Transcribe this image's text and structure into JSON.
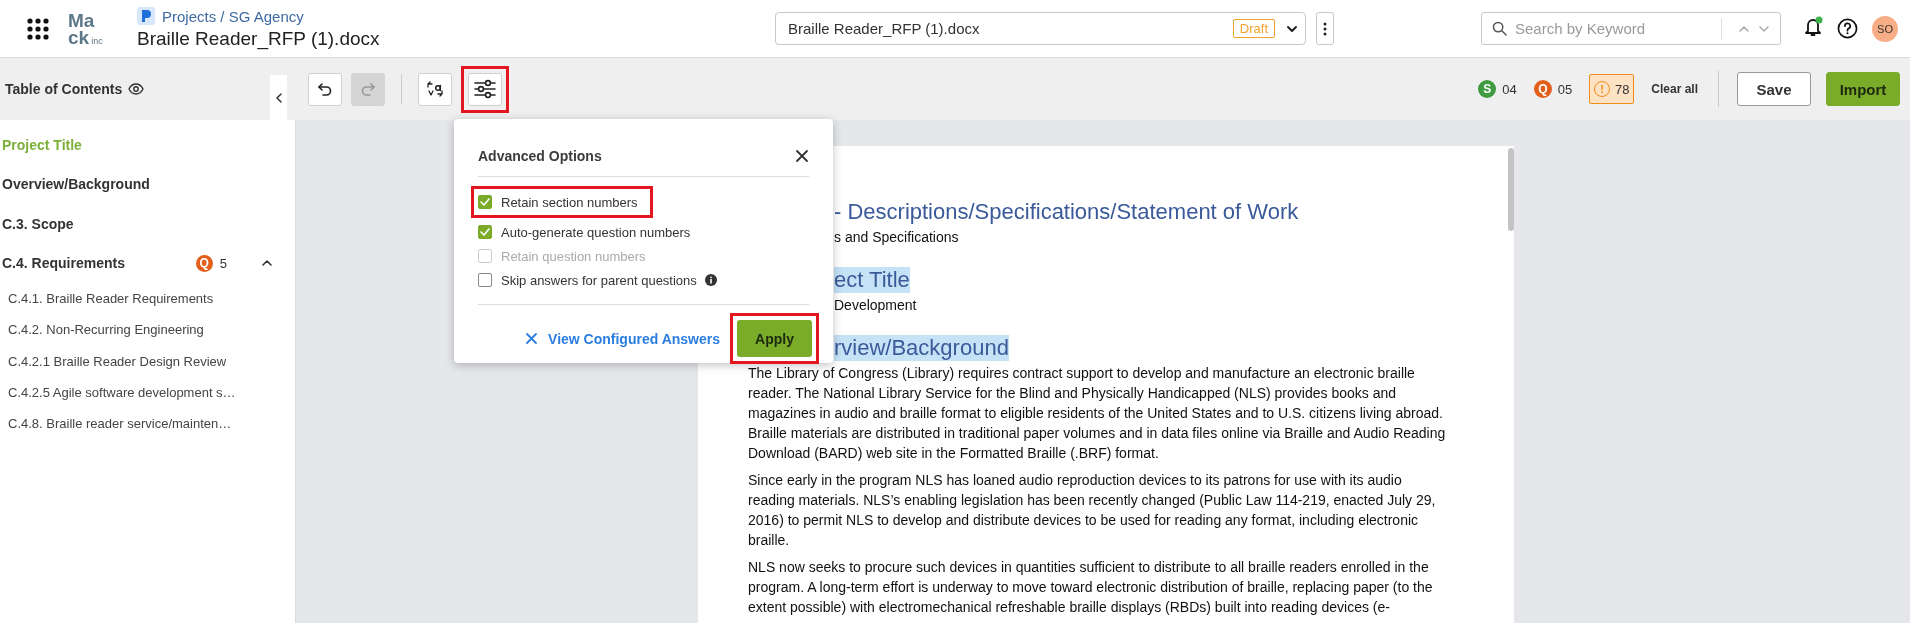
{
  "header": {
    "logo": {
      "top": "Ma",
      "bottom": "ck",
      "suffix": "inc"
    },
    "breadcrumb": "Projects / SG Agency",
    "title": "Braille Reader_RFP (1).docx",
    "document_select": {
      "value": "Braille Reader_RFP (1).docx",
      "status": "Draft"
    },
    "search": {
      "placeholder": "Search by Keyword"
    },
    "notifications": {
      "unread": true
    },
    "avatar": "SO"
  },
  "sidebar": {
    "title": "Table of Contents",
    "items": [
      {
        "label": "Project Title",
        "selected": true
      },
      {
        "label": "Overview/Background",
        "selected": false
      },
      {
        "label": "C.3. Scope",
        "selected": false
      },
      {
        "label": "C.4. Requirements",
        "selected": false,
        "badge": "Q",
        "count": "5",
        "expanded": true,
        "children": [
          {
            "label": "C.4.1. Braille Reader Requirements",
            "selected": false
          },
          {
            "label": "C.4.2. Non-Recurring Engineering",
            "selected": false
          },
          {
            "label": "C.4.2.1 Braille Reader Design Review",
            "selected": false
          },
          {
            "label": "C.4.2.5 Agile software development s…",
            "selected": false
          },
          {
            "label": "C.4.8. Braille reader service/mainten…",
            "selected": false
          }
        ]
      }
    ]
  },
  "toolbar": {
    "tools": [
      {
        "kind": "undo",
        "disabled": false,
        "highlighted": false
      },
      {
        "kind": "redo",
        "disabled": true,
        "highlighted": false
      },
      {
        "kind": "translate",
        "disabled": false,
        "highlighted": false
      },
      {
        "kind": "settings",
        "disabled": false,
        "highlighted": true
      }
    ],
    "counters": [
      {
        "kind": "badge",
        "label": "S",
        "count": "04",
        "color": "#3e9b40"
      },
      {
        "kind": "badge",
        "label": "Q",
        "count": "05",
        "color": "#e2601b"
      },
      {
        "kind": "warning",
        "label": "!",
        "count": "78",
        "color": "#f08c1a"
      }
    ],
    "clear_all": "Clear all",
    "buttons": [
      {
        "label": "Save",
        "kind": "secondary"
      },
      {
        "label": "Import",
        "kind": "primary"
      }
    ]
  },
  "popup": {
    "title": "Advanced Options",
    "options": [
      {
        "label": "Retain section numbers",
        "checked": true,
        "disabled": false,
        "highlighted": true,
        "info": false
      },
      {
        "label": "Auto-generate question numbers",
        "checked": true,
        "disabled": false,
        "highlighted": false,
        "info": false
      },
      {
        "label": "Retain question numbers",
        "checked": false,
        "disabled": true,
        "highlighted": false,
        "info": false
      },
      {
        "label": "Skip answers for parent questions",
        "checked": false,
        "disabled": false,
        "highlighted": false,
        "info": true
      }
    ],
    "link": "View Configured Answers",
    "apply": {
      "label": "Apply",
      "highlighted": true
    }
  },
  "document": {
    "blocks": [
      {
        "kind": "heading",
        "text": "- Descriptions/Specifications/Statement of Work"
      },
      {
        "kind": "subtext",
        "text": "s and Specifications"
      },
      {
        "kind": "marked",
        "text": "ect Title"
      },
      {
        "kind": "subtext",
        "text": "Development"
      },
      {
        "kind": "marked",
        "text": "rview/Background"
      },
      {
        "kind": "paragraph",
        "text": "The Library of Congress (Library) requires contract support to develop and manufacture an electronic braille reader. The National Library Service for the Blind and Physically Handicapped (NLS) provides books and magazines in audio and braille format to eligible residents of the United States and to U.S. citizens living abroad. Braille materials are distributed in traditional paper volumes and in data files online via Braille and Audio Reading Download (BARD) web site in the Formatted Braille (.BRF) format."
      },
      {
        "kind": "paragraph",
        "text": "Since early in the program NLS has loaned audio reproduction devices to its patrons for use with its audio reading materials. NLS’s enabling legislation has been recently changed (Public Law 114-219, enacted July 29, 2016) to permit NLS to develop and distribute devices to be used for reading any format, including electronic braille."
      },
      {
        "kind": "paragraph",
        "text": "NLS now seeks to procure such devices in quantities sufficient to distribute to all braille readers enrolled in the program. A long-term effort is underway to move toward electronic distribution of braille, replacing paper (to the extent possible) with electromechanical refreshable braille displays (RBDs) built into reading devices (e-"
      }
    ]
  }
}
